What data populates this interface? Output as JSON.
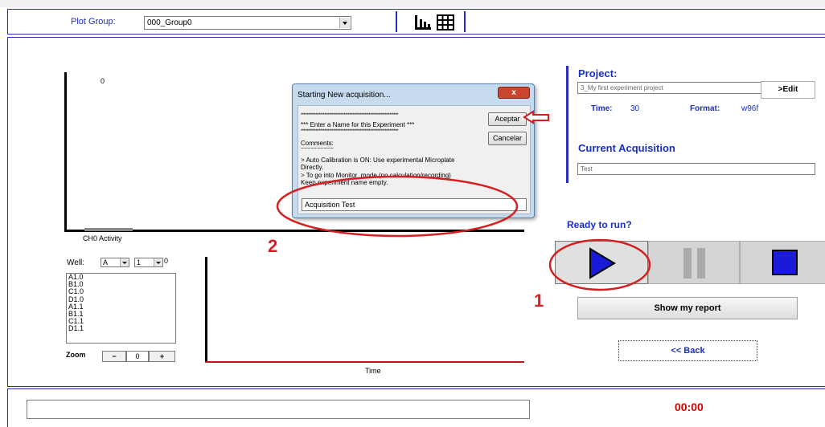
{
  "toolbar": {
    "plot_group_label": "Plot Group:",
    "plot_group_value": "000_Group0",
    "bar_chart_icon": "bar-chart-icon",
    "grid_icon": "grid-icon"
  },
  "charts": {
    "top_value": "0",
    "activity_label": "CH0 Activity",
    "time_label": "Time"
  },
  "dialog": {
    "title": "Starting New acquisition...",
    "close": "x",
    "stars1": "******************************************************************",
    "prompt": "***   Enter a Name for this Experiment  ***",
    "stars2": "******************************************************************",
    "comments": "Comments:",
    "tildes": "~~~~~~~~~~",
    "line1": "> Auto Calibration is ON: Use experimental Microplate",
    "line1b": "Directly.",
    "line2": "> To go into Monitor_mode (no calculation/recording)",
    "line2b": "Keep experiment name empty.",
    "accept": "Aceptar",
    "cancel": "Cancelar",
    "input_value": "Acquisition Test"
  },
  "project": {
    "heading": "Project:",
    "name": "3_My first experiment project",
    "edit": ">Edit",
    "time_label": "Time:",
    "time_value": "30",
    "format_label": "Format:",
    "format_value": "w96f"
  },
  "acquisition": {
    "heading": "Current Acquisition",
    "value": "Test"
  },
  "run": {
    "heading": "Ready to run?",
    "show_report": "Show my report",
    "back": "<< Back"
  },
  "well": {
    "label": "Well:",
    "row": "A",
    "col": "1",
    "count": "0",
    "items": [
      "A1.0",
      "B1.0",
      "C1.0",
      "D1.0",
      "A1.1",
      "B1.1",
      "C1.1",
      "D1.1"
    ]
  },
  "zoom": {
    "label": "Zoom",
    "minus": "−",
    "value": "0",
    "plus": "+"
  },
  "status": {
    "timer": "00:00"
  },
  "annotations": {
    "one": "1",
    "two": "2"
  },
  "colors": {
    "accent": "#2c2cc0",
    "highlight": "#d42020",
    "play": "#1a1ad8"
  }
}
